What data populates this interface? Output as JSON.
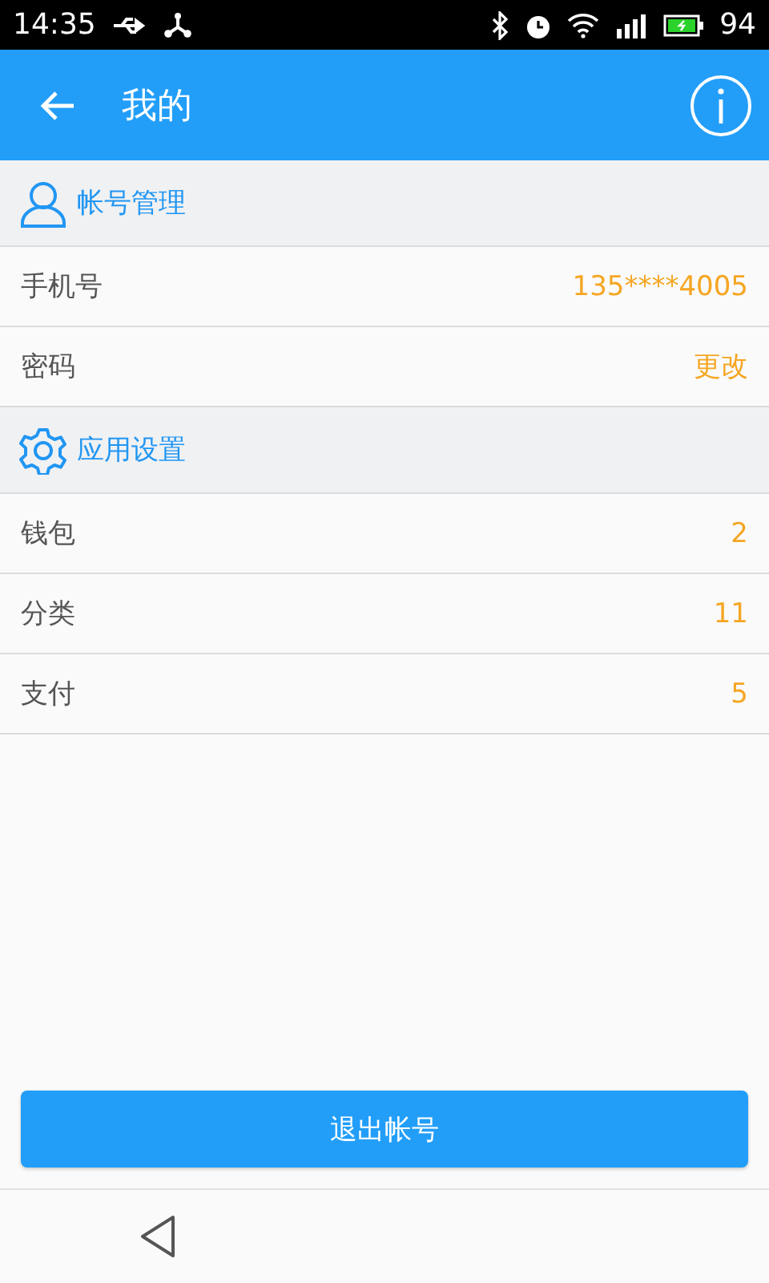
{
  "status_bar": {
    "time": "14:35",
    "battery": "94"
  },
  "app_bar": {
    "title": "我的"
  },
  "sections": [
    {
      "title": "帐号管理",
      "kind": "account",
      "rows": [
        {
          "label": "手机号",
          "value": "135****4005"
        },
        {
          "label": "密码",
          "value": "更改"
        }
      ]
    },
    {
      "title": "应用设置",
      "kind": "settings",
      "rows": [
        {
          "label": "钱包",
          "value": "2"
        },
        {
          "label": "分类",
          "value": "11"
        },
        {
          "label": "支付",
          "value": "5"
        }
      ]
    }
  ],
  "logout_button": "退出帐号"
}
